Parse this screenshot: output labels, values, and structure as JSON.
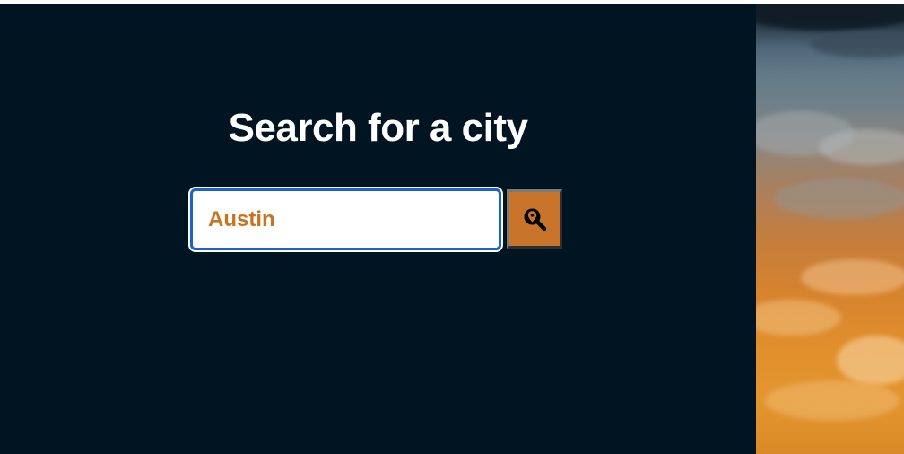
{
  "page": {
    "title": "Search for a city"
  },
  "search": {
    "value": "Austin",
    "placeholder": "",
    "button_icon": "search-location-icon"
  },
  "colors": {
    "panel_background": "#011421",
    "title_text": "#ffffff",
    "input_text": "#c8741f",
    "input_border": "#1a64c8",
    "button_background": "#c8742a"
  },
  "background_image": {
    "subject": "sunset-clouds-photo"
  }
}
